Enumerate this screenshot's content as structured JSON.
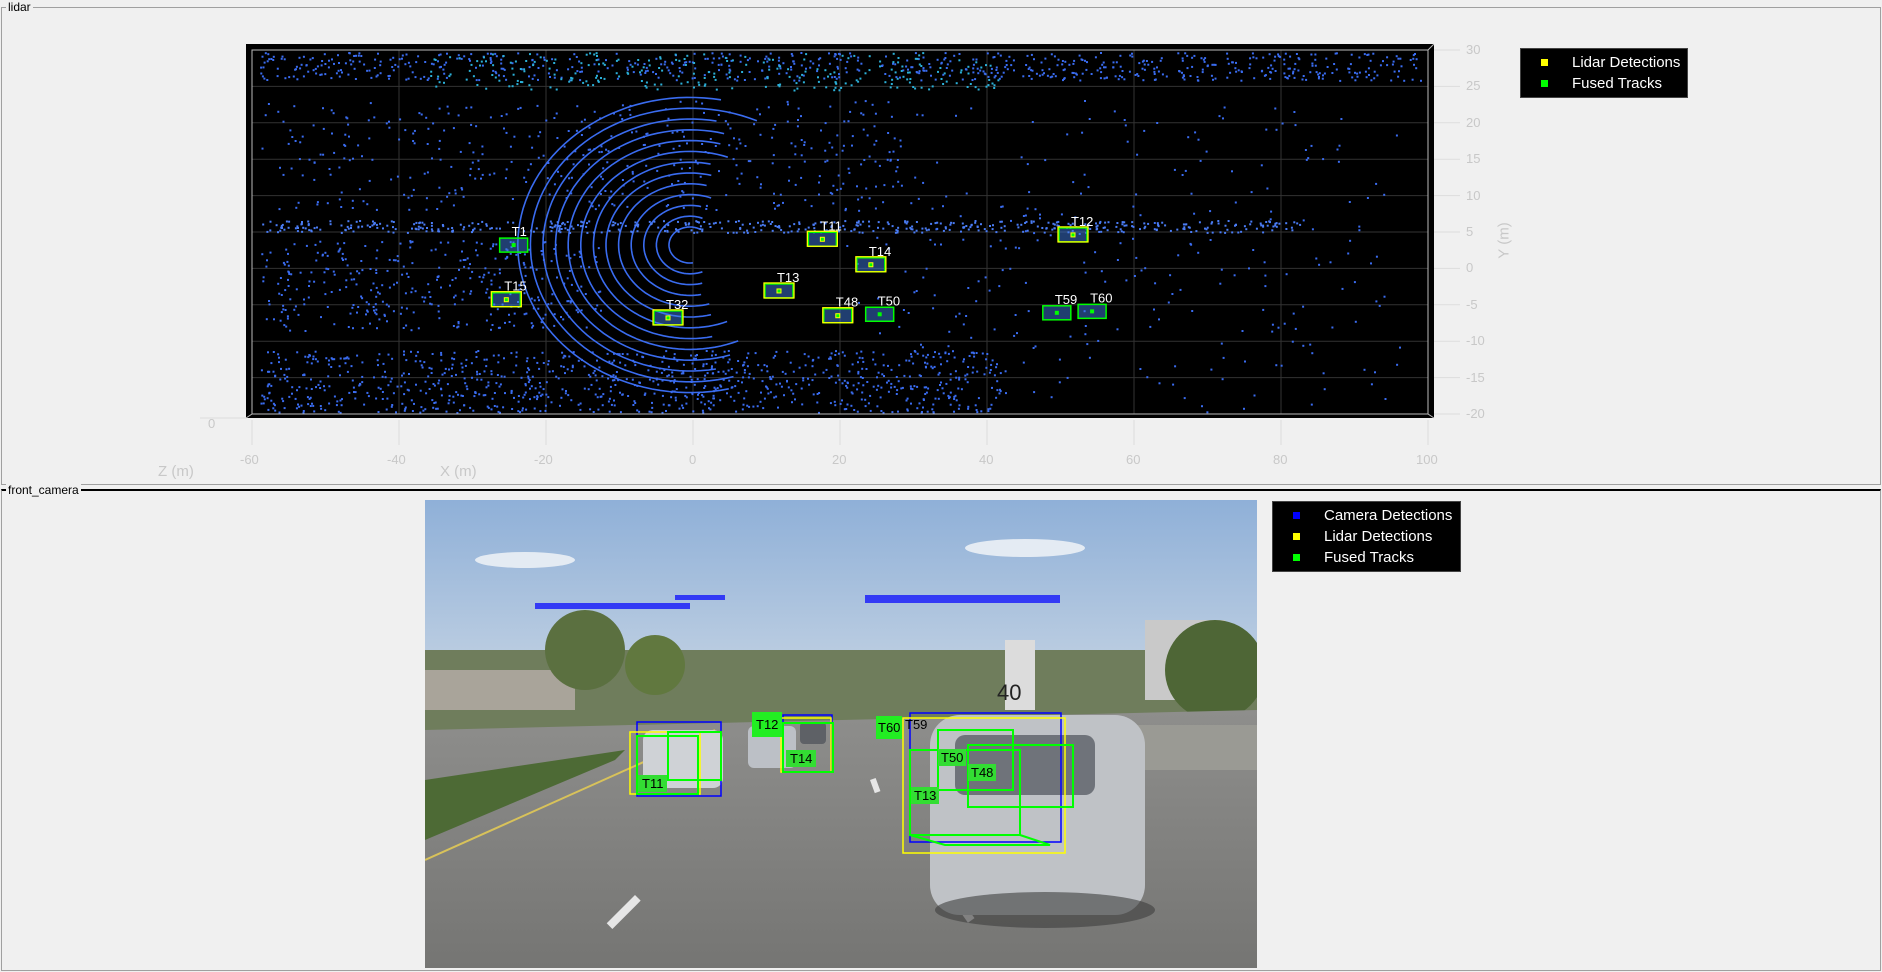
{
  "panels": {
    "lidar": {
      "title": "lidar"
    },
    "camera": {
      "title": "front_camera"
    }
  },
  "lidar_plot": {
    "xlabel": "X (m)",
    "ylabel": "Y (m)",
    "zlabel": "Z (m)",
    "z_tick": "0",
    "xlim": [
      -60,
      100
    ],
    "ylim": [
      -20,
      30
    ],
    "x_ticks": [
      "-60",
      "-40",
      "-20",
      "0",
      "20",
      "40",
      "60",
      "80",
      "100"
    ],
    "y_ticks": [
      "30",
      "25",
      "20",
      "15",
      "10",
      "5",
      "0",
      "-5",
      "-10",
      "-15",
      "-20"
    ],
    "background": "#000000",
    "point_color": "#3a6cf0",
    "legend": [
      {
        "label": "Lidar Detections",
        "color": "#ffff00"
      },
      {
        "label": "Fused Tracks",
        "color": "#00ff00"
      }
    ],
    "tracks": [
      {
        "label": "T1",
        "x": -24.4,
        "y": 3.2,
        "lidar": false
      },
      {
        "label": "T15",
        "x": -25.4,
        "y": -4.3,
        "lidar": true
      },
      {
        "label": "T32",
        "x": -3.4,
        "y": -6.8,
        "lidar": true
      },
      {
        "label": "T13",
        "x": 11.7,
        "y": -3.1,
        "lidar": true
      },
      {
        "label": "T11",
        "x": 17.6,
        "y": 4.0,
        "lidar": true
      },
      {
        "label": "T14",
        "x": 24.2,
        "y": 0.5,
        "lidar": true
      },
      {
        "label": "T48",
        "x": 19.7,
        "y": -6.5,
        "lidar": true
      },
      {
        "label": "T50",
        "x": 25.4,
        "y": -6.3,
        "lidar": false
      },
      {
        "label": "T12",
        "x": 51.7,
        "y": 4.6,
        "lidar": true
      },
      {
        "label": "T59",
        "x": 49.5,
        "y": -6.1,
        "lidar": false
      },
      {
        "label": "T60",
        "x": 54.3,
        "y": -5.9,
        "lidar": false
      }
    ]
  },
  "camera_view": {
    "legend": [
      {
        "label": "Camera Detections",
        "color": "#0000ff"
      },
      {
        "label": "Lidar Detections",
        "color": "#ffff00"
      },
      {
        "label": "Fused Tracks",
        "color": "#00ff00"
      }
    ],
    "track_labels": [
      "T11",
      "T12",
      "T14",
      "T60",
      "T59",
      "T50",
      "T48",
      "T13"
    ],
    "sign_text": "40"
  }
}
